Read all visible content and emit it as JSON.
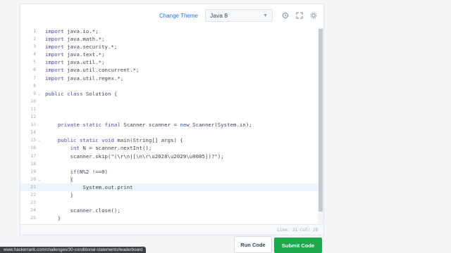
{
  "toolbar": {
    "change_theme": "Change Theme",
    "language": "Java 8",
    "icons": [
      "history-icon",
      "fullscreen-icon",
      "settings-icon"
    ]
  },
  "editor": {
    "lines": [
      {
        "num": "1",
        "fold": "",
        "code": "import java.io.*;"
      },
      {
        "num": "2",
        "fold": "",
        "code": "import java.math.*;"
      },
      {
        "num": "3",
        "fold": "",
        "code": "import java.security.*;"
      },
      {
        "num": "4",
        "fold": "",
        "code": "import java.text.*;"
      },
      {
        "num": "5",
        "fold": "",
        "code": "import java.util.*;"
      },
      {
        "num": "6",
        "fold": "",
        "code": "import java.util.concurrent.*;"
      },
      {
        "num": "7",
        "fold": "",
        "code": "import java.util.regex.*;"
      },
      {
        "num": "8",
        "fold": "",
        "code": ""
      },
      {
        "num": "9",
        "fold": "v",
        "code": "public class Solution {"
      },
      {
        "num": "10",
        "fold": "",
        "code": ""
      },
      {
        "num": "11",
        "fold": "",
        "code": ""
      },
      {
        "num": "12",
        "fold": "",
        "code": ""
      },
      {
        "num": "13",
        "fold": "",
        "code": "    private static final Scanner scanner = new Scanner(System.in);"
      },
      {
        "num": "14",
        "fold": "",
        "code": ""
      },
      {
        "num": "15",
        "fold": "v",
        "code": "    public static void main(String[] args) {"
      },
      {
        "num": "16",
        "fold": "",
        "code": "        int N = scanner.nextInt();"
      },
      {
        "num": "17",
        "fold": "",
        "code": "        scanner.skip(\"(\\r\\n|[\\n\\r\\u2028\\u2029\\u0085])?\");"
      },
      {
        "num": "18",
        "fold": "",
        "code": ""
      },
      {
        "num": "19",
        "fold": "",
        "code": "        if(N%2 !==0)"
      },
      {
        "num": "20",
        "fold": "v",
        "code": "        {"
      },
      {
        "num": "21",
        "fold": "",
        "code": "            System.out.print"
      },
      {
        "num": "22",
        "fold": "",
        "code": "        }"
      },
      {
        "num": "23",
        "fold": "",
        "code": ""
      },
      {
        "num": "24",
        "fold": "",
        "code": "        scanner.close();"
      },
      {
        "num": "25",
        "fold": "",
        "code": "    }"
      }
    ],
    "active_line": 21,
    "status": "Line: 21 Col: 29"
  },
  "browser_status_url": "www.hackerrank.com/challenges/30-conditional-statements/leaderboard",
  "buttons": {
    "run": "Run Code",
    "submit": "Submit Code"
  },
  "colors": {
    "accent": "#1f6feb",
    "submit": "#1ba94c"
  }
}
